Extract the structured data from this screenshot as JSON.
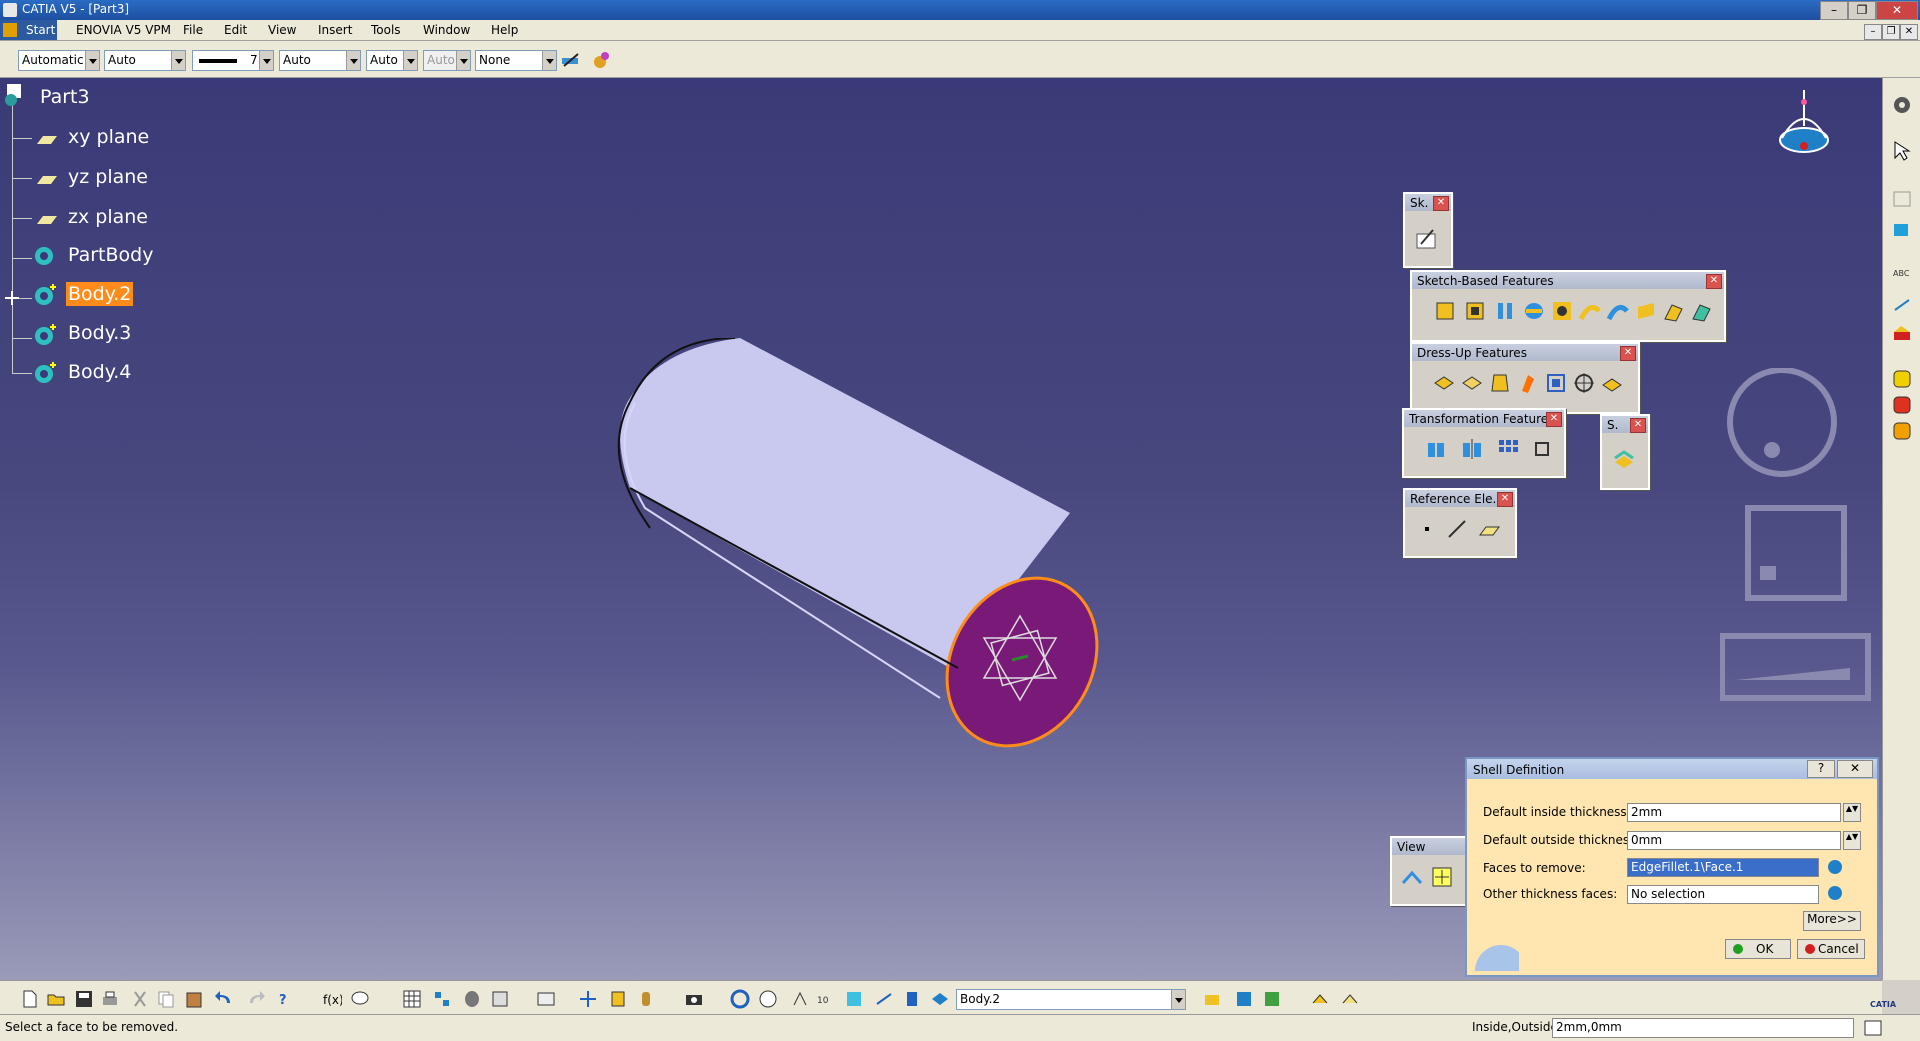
{
  "window": {
    "title": "CATIA V5 - [Part3]",
    "minimize": "–",
    "restore": "❐",
    "close": "✕"
  },
  "menu": {
    "start": "Start",
    "items": [
      "ENOVIA V5 VPM",
      "File",
      "Edit",
      "View",
      "Insert",
      "Tools",
      "Window",
      "Help"
    ]
  },
  "mdi": {
    "minimize": "–",
    "restore": "❐",
    "close": "✕"
  },
  "toolbar": {
    "color": "Automatic",
    "transparency": "Auto",
    "line_weight": "7",
    "line_type": "Auto",
    "point_type": "Auto",
    "layer_disabled": "Auto",
    "layer": "None"
  },
  "tree": {
    "root": "Part3",
    "items": [
      "xy plane",
      "yz plane",
      "zx plane",
      "PartBody",
      "Body.2",
      "Body.3",
      "Body.4"
    ],
    "selected": "Body.2"
  },
  "panels": {
    "sketcher": "Sk.",
    "sketch_based": "Sketch-Based Features",
    "dress_up": "Dress-Up Features",
    "transformation": "Transformation Features",
    "surface": "S.",
    "reference": "Reference Ele...",
    "view": "View",
    "close": "✕"
  },
  "dialog": {
    "title": "Shell Definition",
    "help": "?",
    "close": "✕",
    "inside_label": "Default inside thickness:",
    "inside_value": "2mm",
    "outside_label": "Default outside thickness:",
    "outside_value": "0mm",
    "faces_label": "Faces to remove:",
    "faces_value": "EdgeFillet.1\\Face.1",
    "other_label": "Other thickness faces:",
    "other_value": "No selection",
    "more": "More>>",
    "ok": "OK",
    "cancel": "Cancel"
  },
  "bottom_toolbar": {
    "current_body": "Body.2"
  },
  "status": {
    "message": "Select a face to be removed.",
    "prompt_label": "Inside,Outside",
    "prompt_value": "2mm,0mm"
  },
  "colors": {
    "background_top": "#3a3a78",
    "background_bottom": "#9a9ab9",
    "selection": "#ff8c1a",
    "face_highlight": "#7a1a78",
    "cylinder": "#c9c9f0"
  }
}
